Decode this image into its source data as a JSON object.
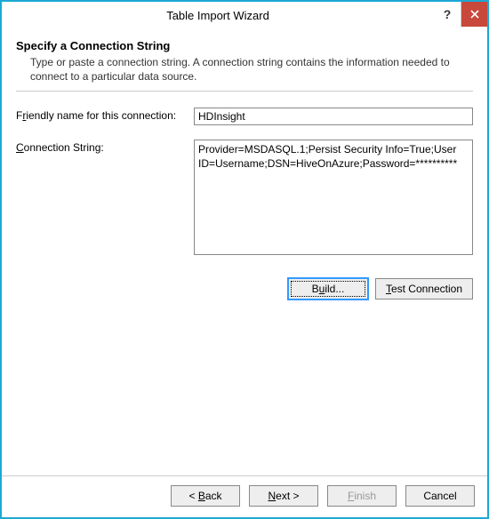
{
  "window": {
    "title": "Table Import Wizard"
  },
  "page": {
    "heading": "Specify a Connection String",
    "subheading": "Type or paste a connection string. A connection string contains the information needed to connect to a particular data source."
  },
  "form": {
    "friendly_name": {
      "label_pre": "F",
      "label_underlined": "r",
      "label_post": "iendly name for this connection:",
      "value": "HDInsight"
    },
    "connection_string": {
      "label_underlined": "C",
      "label_post": "onnection String:",
      "value": "Provider=MSDASQL.1;Persist Security Info=True;User ID=Username;DSN=HiveOnAzure;Password=**********"
    }
  },
  "buttons": {
    "build": {
      "pre": "B",
      "under": "u",
      "post": "ild..."
    },
    "test_connection": {
      "under": "T",
      "post": "est Connection"
    },
    "back": {
      "pre": "< ",
      "under": "B",
      "post": "ack"
    },
    "next": {
      "under": "N",
      "post": "ext >"
    },
    "finish": {
      "under": "F",
      "post": "inish"
    },
    "cancel": "Cancel"
  }
}
